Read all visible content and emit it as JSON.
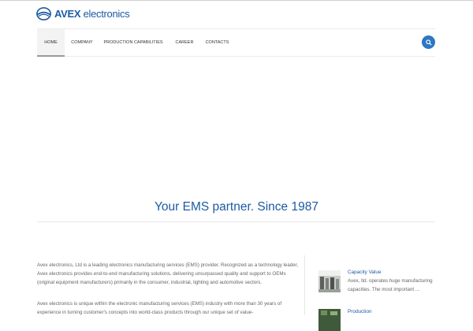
{
  "logo": {
    "brand": "AVEX",
    "suffix": "electronics"
  },
  "nav": {
    "items": [
      {
        "label": "HOME",
        "active": true
      },
      {
        "label": "COMPANY",
        "active": false
      },
      {
        "label": "PRODUCTION CAPABILITIES",
        "active": false
      },
      {
        "label": "CAREER",
        "active": false
      },
      {
        "label": "CONTACTS",
        "active": false
      }
    ]
  },
  "hero": {
    "title": "Your EMS partner. Since 1987"
  },
  "intro": {
    "paragraph1": "Avex electronics, Ltd is a leading electronics manufacturing services (EMS) provider. Recognized as a technology leader, Avex electronics provides end-to-end manufacturing solutions, delivering unsurpassed quality and support to OEMs (original equipment manufacturers) primarily in the consumer, industrial, lighting and automotive sectors.",
    "paragraph2": "Avex electronics is unique within the electronic manufacturing services (EMS) industry with more than 30 years of experience in turning customer's concepts into world-class products through our unique set of value-"
  },
  "news": [
    {
      "title": "Capacity Value",
      "text": "Avex, ltd. operates huge manufacturing capacities. The most important ..."
    },
    {
      "title": "Production",
      "text": ""
    }
  ],
  "colors": {
    "brand_blue": "#1d5aa3",
    "search_button": "#2e78c1"
  }
}
